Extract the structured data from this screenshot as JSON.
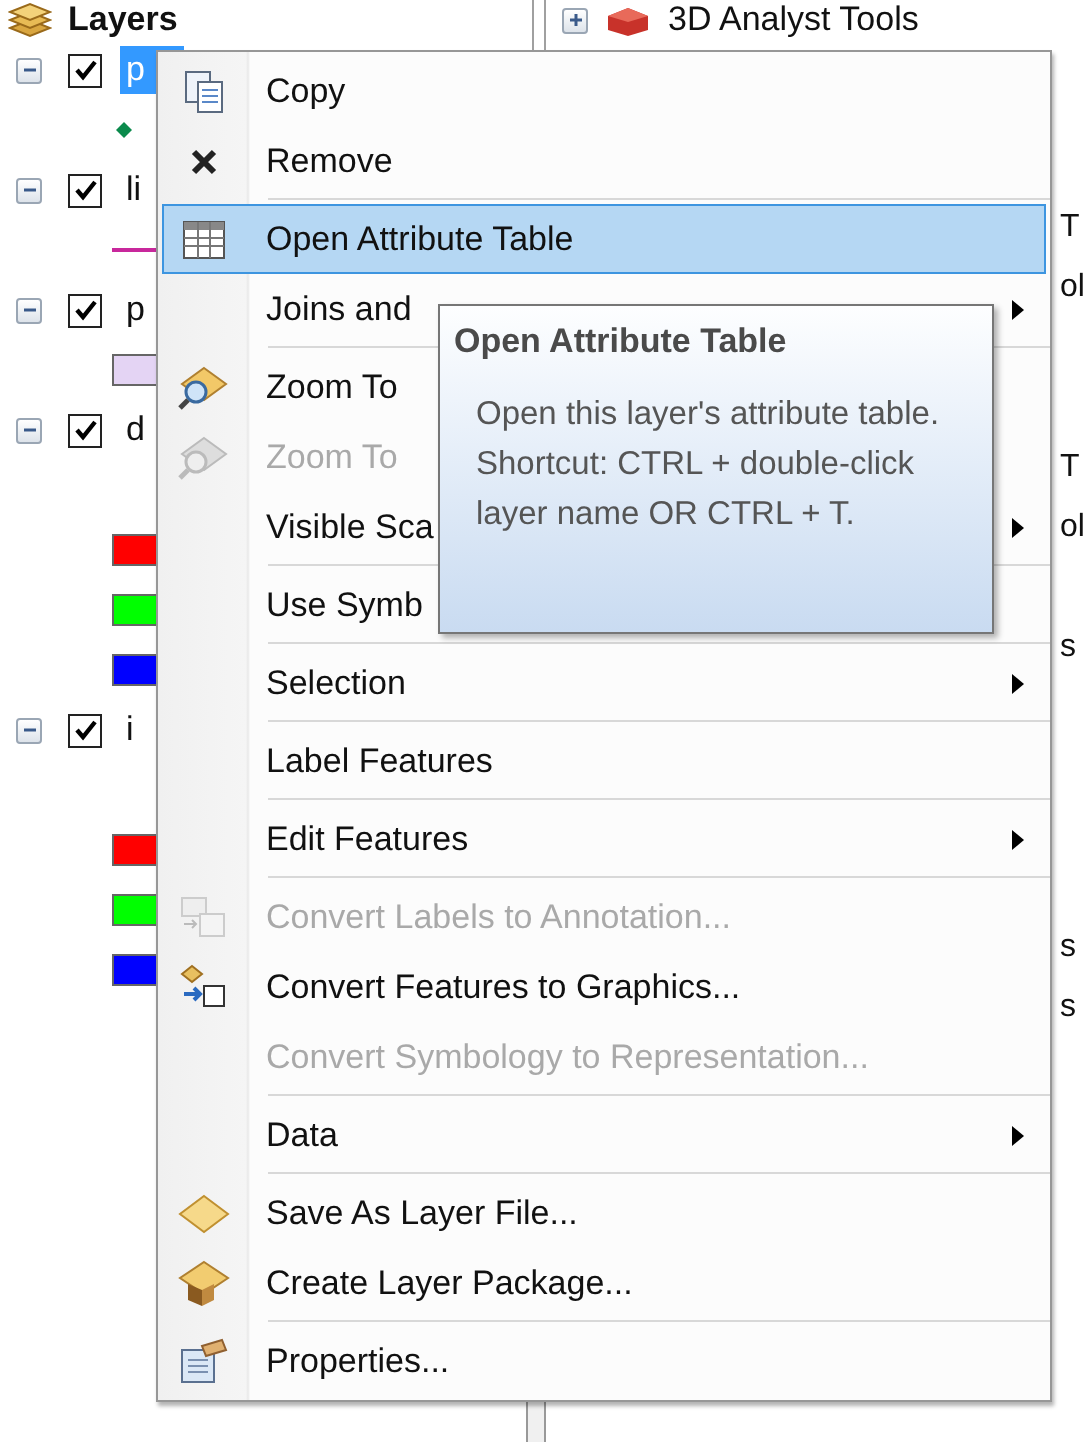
{
  "layers_panel": {
    "title": "Layers",
    "layers": [
      {
        "name": "p",
        "kind": "vector",
        "checked": true,
        "expanded": true,
        "selected": true,
        "symbols": [
          {
            "kind": "point",
            "color": "#0b8a4c"
          }
        ]
      },
      {
        "name": "li",
        "kind": "vector",
        "checked": true,
        "expanded": true,
        "selected": false,
        "symbols": [
          {
            "kind": "line",
            "color": "#c8289c"
          }
        ]
      },
      {
        "name": "p",
        "kind": "vector",
        "checked": true,
        "expanded": true,
        "selected": false,
        "symbols": [
          {
            "kind": "fill",
            "color": "#e4d4f4"
          }
        ]
      },
      {
        "name": "d",
        "kind": "raster",
        "checked": true,
        "expanded": true,
        "selected": false,
        "symbols": [
          {
            "kind": "fill",
            "color": "#ff0000"
          },
          {
            "kind": "fill",
            "color": "#00ff00"
          },
          {
            "kind": "fill",
            "color": "#0000ff"
          }
        ]
      },
      {
        "name": "i",
        "kind": "raster",
        "checked": true,
        "expanded": true,
        "selected": false,
        "symbols": [
          {
            "kind": "fill",
            "color": "#ff0000"
          },
          {
            "kind": "fill",
            "color": "#00ff00"
          },
          {
            "kind": "fill",
            "color": "#0000ff"
          }
        ]
      }
    ]
  },
  "toolbox_panel": {
    "items": [
      {
        "label": "3D Analyst Tools",
        "expanded": false
      }
    ],
    "fragments": [
      "T",
      "ol",
      "T",
      "ol",
      "s",
      "s",
      "s"
    ]
  },
  "context_menu": {
    "items": [
      {
        "kind": "item",
        "label": "Copy",
        "disabled": false,
        "submenu": false,
        "selected": false
      },
      {
        "kind": "item",
        "label": "Remove",
        "disabled": false,
        "submenu": false,
        "selected": false
      },
      {
        "kind": "separator"
      },
      {
        "kind": "item",
        "label": "Open Attribute Table",
        "disabled": false,
        "submenu": false,
        "selected": true
      },
      {
        "kind": "item",
        "label": "Joins and",
        "disabled": false,
        "submenu": true,
        "selected": false
      },
      {
        "kind": "separator"
      },
      {
        "kind": "item",
        "label": "Zoom To",
        "disabled": false,
        "submenu": false,
        "selected": false
      },
      {
        "kind": "item",
        "label": "Zoom To",
        "disabled": true,
        "submenu": false,
        "selected": false
      },
      {
        "kind": "item",
        "label": "Visible Sca",
        "disabled": false,
        "submenu": true,
        "selected": false
      },
      {
        "kind": "separator"
      },
      {
        "kind": "item",
        "label": "Use Symb",
        "disabled": false,
        "submenu": false,
        "selected": false
      },
      {
        "kind": "separator"
      },
      {
        "kind": "item",
        "label": "Selection",
        "disabled": false,
        "submenu": true,
        "selected": false
      },
      {
        "kind": "separator"
      },
      {
        "kind": "item",
        "label": "Label Features",
        "disabled": false,
        "submenu": false,
        "selected": false
      },
      {
        "kind": "separator"
      },
      {
        "kind": "item",
        "label": "Edit Features",
        "disabled": false,
        "submenu": true,
        "selected": false
      },
      {
        "kind": "separator"
      },
      {
        "kind": "item",
        "label": "Convert Labels to Annotation...",
        "disabled": true,
        "submenu": false,
        "selected": false
      },
      {
        "kind": "item",
        "label": "Convert Features to Graphics...",
        "disabled": false,
        "submenu": false,
        "selected": false
      },
      {
        "kind": "item",
        "label": "Convert Symbology to Representation...",
        "disabled": true,
        "submenu": false,
        "selected": false
      },
      {
        "kind": "separator"
      },
      {
        "kind": "item",
        "label": "Data",
        "disabled": false,
        "submenu": true,
        "selected": false
      },
      {
        "kind": "separator"
      },
      {
        "kind": "item",
        "label": "Save As Layer File...",
        "disabled": false,
        "submenu": false,
        "selected": false
      },
      {
        "kind": "item",
        "label": "Create Layer Package...",
        "disabled": false,
        "submenu": false,
        "selected": false
      },
      {
        "kind": "separator"
      },
      {
        "kind": "item",
        "label": "Properties...",
        "disabled": false,
        "submenu": false,
        "selected": false
      }
    ]
  },
  "tooltip": {
    "title": "Open Attribute Table",
    "text": "Open this layer's attribute table. Shortcut: CTRL + double-click layer name OR CTRL + T."
  }
}
